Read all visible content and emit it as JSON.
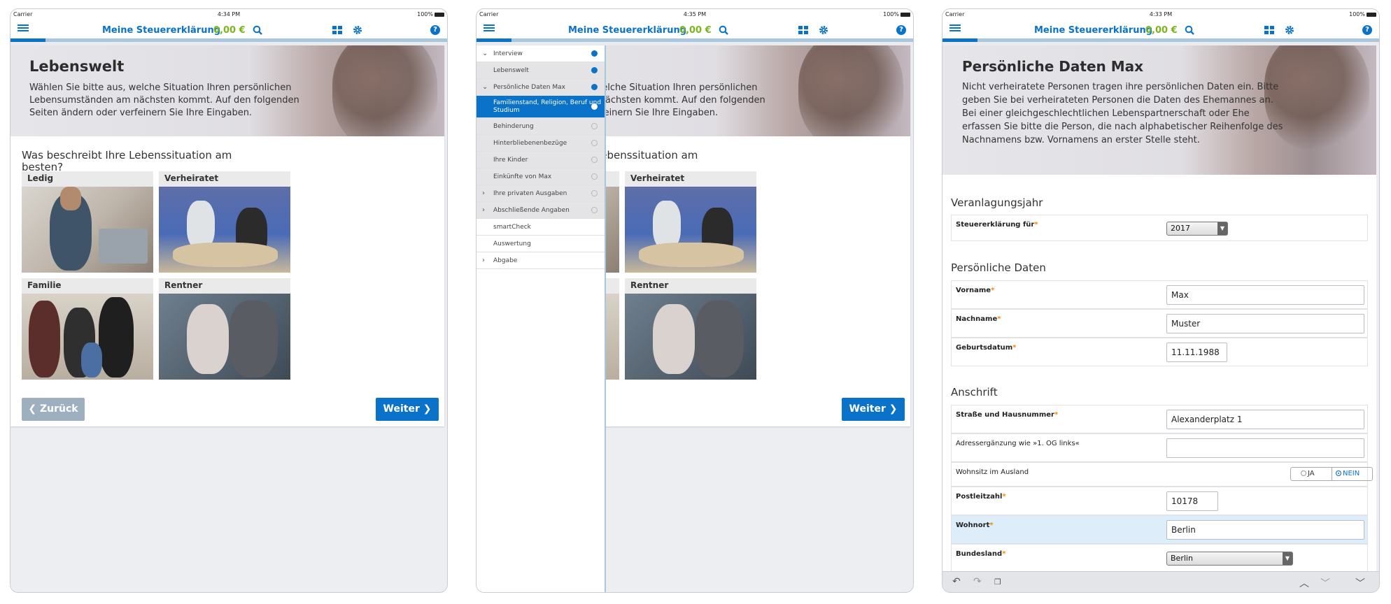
{
  "status_bar": {
    "carrier": "Carrier",
    "battery": "100%"
  },
  "times": [
    "4:34 PM",
    "4:35 PM",
    "4:33 PM"
  ],
  "navbar": {
    "title": "Meine Steuererklärung",
    "amount": "0,00 €",
    "help": "?"
  },
  "colors": {
    "brand_blue": "#0a73c9",
    "amount_green": "#7ab51d",
    "required_orange": "#f08a00"
  },
  "lebenswelt": {
    "title": "Lebenswelt",
    "description": "Wählen Sie bitte aus, welche Situation Ihren persönlichen Lebensumständen am nächsten kommt. Auf den folgenden Seiten ändern oder verfeinern Sie Ihre Eingaben.",
    "question": "Was beschreibt Ihre Lebenssituation am besten?",
    "tiles": [
      "Ledig",
      "Verheiratet",
      "Familie",
      "Rentner"
    ],
    "back": "Zurück",
    "next": "Weiter"
  },
  "sidebar": {
    "items": [
      {
        "label": "Interview",
        "chevron": "expanded",
        "state": "done"
      },
      {
        "label": "Lebenswelt",
        "state": "done"
      },
      {
        "label": "Persönliche Daten Max",
        "chevron": "expanded",
        "state": "done"
      },
      {
        "label": "Familienstand, Religion, Beruf und Studium",
        "state": "active"
      },
      {
        "label": "Behinderung",
        "state": "open"
      },
      {
        "label": "Hinterbliebenenbezüge",
        "state": "open"
      },
      {
        "label": "Ihre Kinder",
        "state": "open"
      },
      {
        "label": "Einkünfte von Max",
        "state": "open"
      },
      {
        "label": "Ihre privaten Ausgaben",
        "chevron": "collapsed",
        "state": "open"
      },
      {
        "label": "Abschließende Angaben",
        "chevron": "collapsed",
        "state": "open"
      },
      {
        "label": "smartCheck"
      },
      {
        "label": "Auswertung"
      },
      {
        "label": "Abgabe",
        "chevron": "collapsed"
      }
    ]
  },
  "form": {
    "title": "Persönliche Daten Max",
    "description": "Nicht verheiratete Personen tragen ihre persönlichen Daten ein. Bitte geben Sie bei verheirateten Personen die Daten des Ehemannes an. Bei einer gleichgeschlechtlichen Lebenspartnerschaft oder Ehe erfassen Sie bitte die Person, die nach alphabetischer Reihenfolge des Nachnamens bzw. Vornamens an erster Stelle steht.",
    "sections": {
      "year": "Veranlagungsjahr",
      "personal": "Persönliche Daten",
      "address": "Anschrift"
    },
    "fields": {
      "steuererklaerung_label": "Steuererklärung für",
      "steuererklaerung_value": "2017",
      "vorname_label": "Vorname",
      "vorname_value": "Max",
      "nachname_label": "Nachname",
      "nachname_value": "Muster",
      "geburtsdatum_label": "Geburtsdatum",
      "geburtsdatum_value": "11.11.1988",
      "strasse_label": "Straße und Hausnummer",
      "strasse_value": "Alexanderplatz 1",
      "adress_label": "Adressergänzung wie »1. OG links«",
      "adress_value": "",
      "ausland_label": "Wohnsitz im Ausland",
      "ausland_ja": "JA",
      "ausland_nein": "NEIN",
      "ausland_selected": "NEIN",
      "plz_label": "Postleitzahl",
      "plz_value": "10178",
      "wohnort_label": "Wohnort",
      "wohnort_value": "Berlin",
      "bundesland_label": "Bundesland",
      "bundesland_value": "Berlin"
    },
    "required_mark": "*"
  },
  "icons": [
    "menu-icon",
    "search-icon",
    "grid-icon",
    "gear-icon",
    "help-icon",
    "undo-icon",
    "redo-icon",
    "copy-icon",
    "chevron-up-icon",
    "chevron-down-icon"
  ]
}
